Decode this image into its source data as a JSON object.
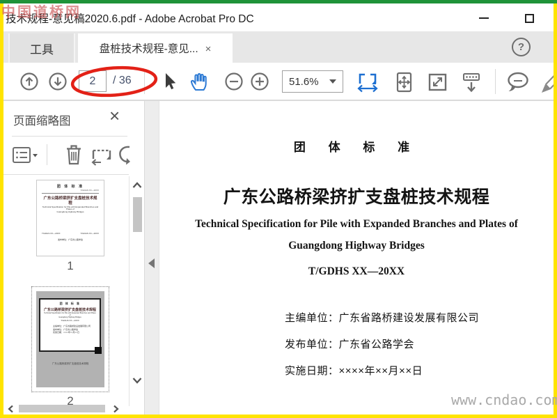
{
  "window": {
    "title": "技术规程-意见稿2020.6.pdf - Adobe Acrobat Pro DC"
  },
  "watermark": {
    "top_left": "中国道桥网",
    "bottom_right": "www.cndao.com"
  },
  "tab_bar": {
    "tools_tab": "工具",
    "document_tab": "盘桩技术规程-意见...",
    "close_glyph": "×",
    "help_glyph": "?"
  },
  "toolbar": {
    "page_current": "2",
    "page_total": "/ 36",
    "zoom_level": "51.6%"
  },
  "sidebar": {
    "title": "页面缩略图",
    "close_glyph": "×",
    "thumb1_label": "1",
    "thumb2_label": "2"
  },
  "document": {
    "header": "团 体 标 准",
    "title": "广东公路桥梁挤扩支盘桩技术规程",
    "subtitle_en1": "Technical Specification for Pile with Expanded Branches and Plates of",
    "subtitle_en2": "Guangdong Highway Bridges",
    "standard_number": "T/GDHS XX—20XX",
    "chief_editor": "主编单位：广东省路桥建设发展有限公司",
    "publisher": "发布单位：广东省公路学会",
    "implementation_date": "实施日期：××××年××月××日"
  },
  "colors": {
    "frame_yellow": "#ffe400",
    "frame_green": "#1f9339",
    "accent_blue": "#1d6fd1",
    "annotation_red": "#e32117",
    "icon_gray": "#6e6e6e"
  }
}
